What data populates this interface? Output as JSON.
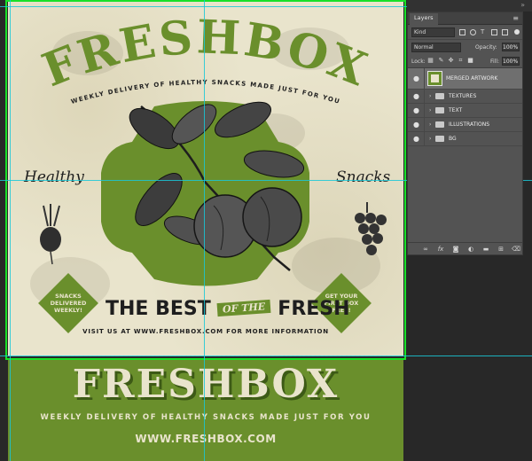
{
  "artwork": {
    "title": "FRESHBOX",
    "subtitle": "WEEKLY DELIVERY OF HEALTHY SNACKS MADE JUST FOR YOU",
    "script_left": "Healthy",
    "script_right": "Snacks",
    "best_pre": "THE BEST",
    "best_ribbon": "OF THE",
    "best_post": "FRESH",
    "visit": "VISIT US AT WWW.FRESHBOX.COM FOR MORE INFORMATION",
    "badge_left": [
      "SNACKS",
      "DELIVERED",
      "WEEKLY!"
    ],
    "badge_right": [
      "GET YOUR",
      "FIRST BOX",
      "FREE!"
    ]
  },
  "banner": {
    "title": "FRESHBOX",
    "subtitle": "WEEKLY DELIVERY OF HEALTHY SNACKS MADE JUST FOR YOU",
    "url": "WWW.FRESHBOX.COM"
  },
  "layers_panel": {
    "tab_label": "Layers",
    "filter_kind": "Kind",
    "blend_mode": "Normal",
    "opacity_label": "Opacity:",
    "opacity_value": "100%",
    "lock_label": "Lock:",
    "fill_label": "Fill:",
    "fill_value": "100%",
    "layers": [
      {
        "name": "MERGED ARTWORK",
        "type": "layer",
        "visible": true,
        "selected": true
      },
      {
        "name": "TEXTURES",
        "type": "group",
        "visible": true
      },
      {
        "name": "TEXT",
        "type": "group",
        "visible": true
      },
      {
        "name": "ILLUSTRATIONS",
        "type": "group",
        "visible": true
      },
      {
        "name": "BG",
        "type": "group",
        "visible": true
      }
    ]
  },
  "colors": {
    "accent_green": "#6a8f2c",
    "paper": "#e9e4cc",
    "selection": "#18e028",
    "guide": "#19c8d8"
  }
}
